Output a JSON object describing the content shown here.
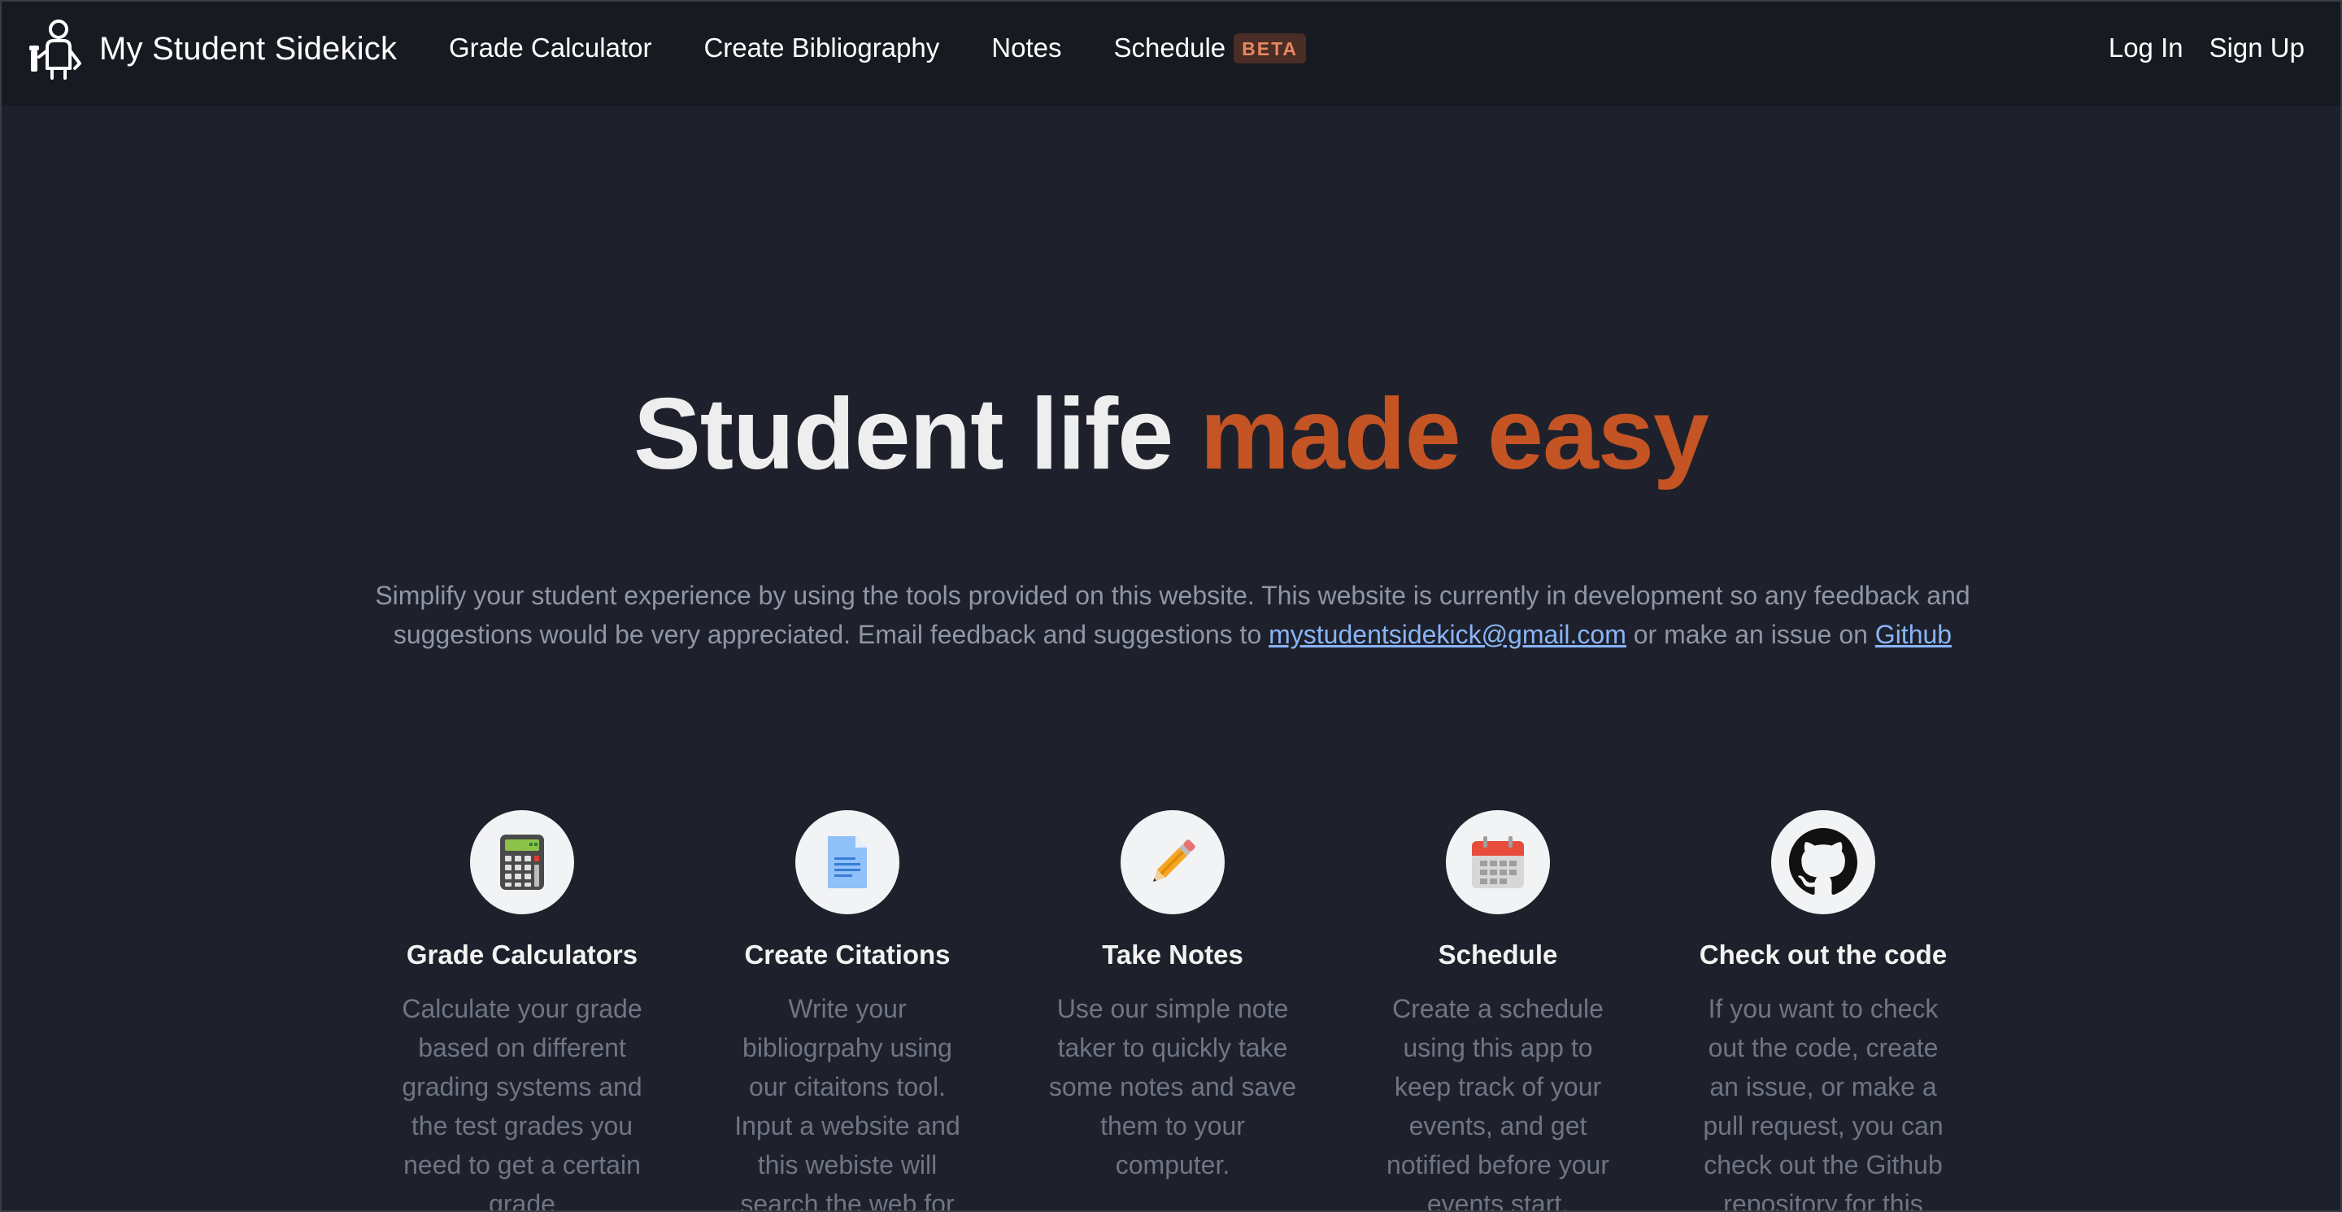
{
  "navbar": {
    "brand": "My Student Sidekick",
    "links": [
      {
        "label": "Grade Calculator"
      },
      {
        "label": "Create Bibliography"
      },
      {
        "label": "Notes"
      },
      {
        "label": "Schedule",
        "badge": "BETA"
      }
    ],
    "auth": {
      "login": "Log In",
      "signup": "Sign Up"
    }
  },
  "hero": {
    "title_plain": "Student life ",
    "title_accent": "made easy",
    "description_before": "Simplify your student experience by using the tools provided on this website. This website is currently in development so any feedback and suggestions would be very appreciated. Email feedback and suggestions to ",
    "email_link": "mystudentsidekick@gmail.com",
    "description_middle": " or make an issue on ",
    "github_link": "Github"
  },
  "features": [
    {
      "icon": "calculator-icon",
      "title": "Grade Calculators",
      "text": "Calculate your grade based on different grading systems and the test grades you need to get a certain grade"
    },
    {
      "icon": "document-icon",
      "title": "Create Citations",
      "text": "Write your bibliogrpahy using our citaitons tool. Input a website and this webiste will search the web for"
    },
    {
      "icon": "pencil-icon",
      "title": "Take Notes",
      "text": "Use our simple note taker to quickly take some notes and save them to your computer."
    },
    {
      "icon": "calendar-icon",
      "title": "Schedule",
      "text": "Create a schedule using this app to keep track of your events, and get notified before your events start."
    },
    {
      "icon": "github-icon",
      "title": "Check out the code",
      "text": "If you want to check out the code, create an issue, or make a pull request, you can check out the Github repository for this"
    }
  ],
  "colors": {
    "background": "#1e212b",
    "navbar": "#171a21",
    "accent": "#c45424",
    "link": "#8ab4f8",
    "badge_bg": "#4a2d25",
    "badge_text": "#e8875f"
  }
}
